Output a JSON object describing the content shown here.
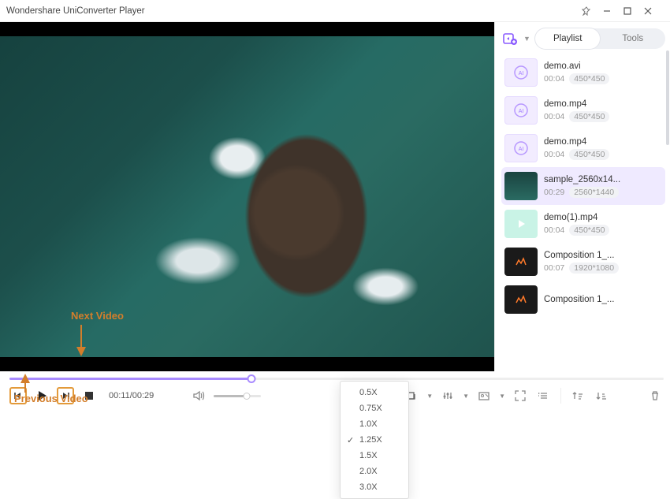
{
  "window": {
    "title": "Wondershare UniConverter Player"
  },
  "tabs": {
    "playlist": "Playlist",
    "tools": "Tools",
    "active": "playlist"
  },
  "playlist": [
    {
      "name": "demo.avi",
      "dur": "00:04",
      "res": "450*450",
      "thumb": "ai"
    },
    {
      "name": "demo.mp4",
      "dur": "00:04",
      "res": "450*450",
      "thumb": "ai"
    },
    {
      "name": "demo.mp4",
      "dur": "00:04",
      "res": "450*450",
      "thumb": "ai"
    },
    {
      "name": "sample_2560x14...",
      "dur": "00:29",
      "res": "2560*1440",
      "thumb": "ocean",
      "active": true
    },
    {
      "name": "demo(1).mp4",
      "dur": "00:04",
      "res": "450*450",
      "thumb": "play"
    },
    {
      "name": "Composition 1_...",
      "dur": "00:07",
      "res": "1920*1080",
      "thumb": "dark"
    },
    {
      "name": "Composition 1_...",
      "dur": "",
      "res": "",
      "thumb": "dark"
    }
  ],
  "controls": {
    "time": "00:11/00:29",
    "speed_label": "1.25x",
    "speed_options": [
      "0.5X",
      "0.75X",
      "1.0X",
      "1.25X",
      "1.5X",
      "2.0X",
      "3.0X"
    ],
    "speed_selected": "1.25X"
  },
  "annotations": {
    "next": "Next Video",
    "prev": "Previous Video"
  }
}
